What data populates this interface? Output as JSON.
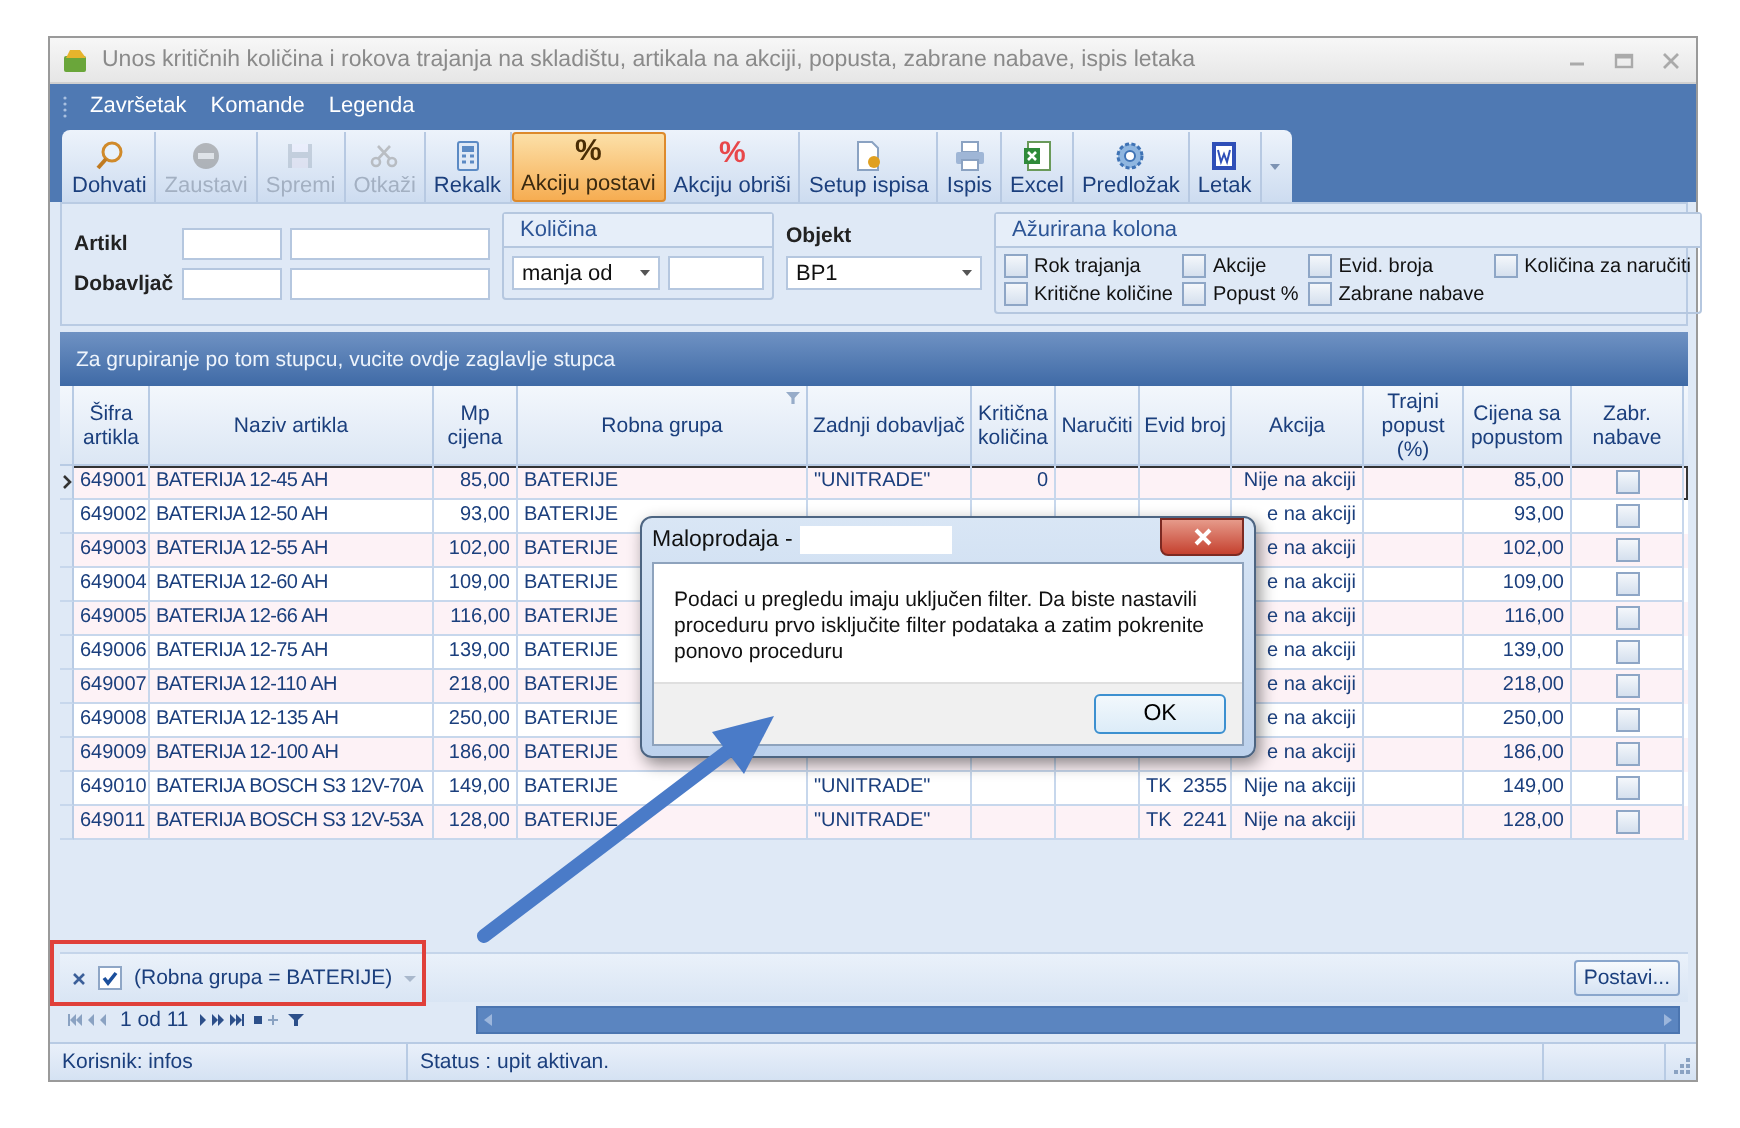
{
  "window": {
    "title": "Unos kritičnih količina i rokova trajanja na skladištu, artikala na akciji, popusta, zabrane nabave, ispis letaka"
  },
  "menu": [
    {
      "label": "Završetak"
    },
    {
      "label": "Komande"
    },
    {
      "label": "Legenda"
    }
  ],
  "toolbar": {
    "buttons": [
      {
        "label": "Dohvati",
        "disabled": false,
        "selected": false
      },
      {
        "label": "Zaustavi",
        "disabled": true,
        "selected": false
      },
      {
        "label": "Spremi",
        "disabled": true,
        "selected": false
      },
      {
        "label": "Otkaži",
        "disabled": true,
        "selected": false
      },
      {
        "label": "Rekalk",
        "disabled": false,
        "selected": false
      },
      {
        "label": "Akciju postavi",
        "glyph": "%",
        "disabled": false,
        "selected": true
      },
      {
        "label": "Akciju obriši",
        "glyph": "%",
        "disabled": false,
        "selected": false
      },
      {
        "label": "Setup ispisa",
        "disabled": false,
        "selected": false
      },
      {
        "label": "Ispis",
        "disabled": false,
        "selected": false
      },
      {
        "label": "Excel",
        "disabled": false,
        "selected": false
      },
      {
        "label": "Predložak",
        "disabled": false,
        "selected": false
      },
      {
        "label": "Letak",
        "disabled": false,
        "selected": false
      }
    ]
  },
  "filters": {
    "artikl_label": "Artikl",
    "dobavljac_label": "Dobavljač",
    "kolicina": {
      "title": "Količina",
      "operator": "manja od"
    },
    "objekt": {
      "label": "Objekt",
      "value": "BP1"
    },
    "azurirana_kolona": {
      "title": "Ažurirana kolona",
      "options": [
        {
          "label": "Rok trajanja",
          "checked": false
        },
        {
          "label": "Akcije",
          "checked": false
        },
        {
          "label": "Evid. broja",
          "checked": false
        },
        {
          "label": "Količina za naručiti",
          "checked": false
        },
        {
          "label": "Kritične količine",
          "checked": false
        },
        {
          "label": "Popust %",
          "checked": false
        },
        {
          "label": "Zabrane nabave",
          "checked": false
        }
      ]
    }
  },
  "grid": {
    "group_panel_hint": "Za grupiranje po tom stupcu, vucite ovdje zaglavlje stupca",
    "columns": [
      {
        "label": "Šifra artikla",
        "filtered": false
      },
      {
        "label": "Naziv artikla",
        "filtered": false
      },
      {
        "label": "Mp cijena",
        "filtered": false
      },
      {
        "label": "Robna grupa",
        "filtered": true
      },
      {
        "label": "Zadnji dobavljač",
        "filtered": false
      },
      {
        "label": "Kritična količina",
        "filtered": false
      },
      {
        "label": "Naručiti",
        "filtered": false
      },
      {
        "label": "Evid broj",
        "filtered": false
      },
      {
        "label": "Akcija",
        "filtered": false
      },
      {
        "label": "Trajni popust (%)",
        "filtered": false
      },
      {
        "label": "Cijena sa popustom",
        "filtered": false
      },
      {
        "label": "Zabr. nabave",
        "filtered": false
      }
    ],
    "rows": [
      {
        "sifra": "649001",
        "naziv": "BATERIJA 12-45 AH",
        "mp_cijena": "85,00",
        "robna_grupa": "BATERIJE",
        "zadnji_dobavljac": "\"UNITRADE\"",
        "kriticna_kolicina": "0",
        "akcija": "Nije na akciji",
        "cijena_sa_popustom": "85,00",
        "zabr_nabave": false,
        "selected": true
      },
      {
        "sifra": "649002",
        "naziv": "BATERIJA 12-50 AH",
        "mp_cijena": "93,00",
        "robna_grupa": "BATERIJE",
        "akcija": "e na akciji",
        "cijena_sa_popustom": "93,00",
        "zabr_nabave": false,
        "selected": false
      },
      {
        "sifra": "649003",
        "naziv": "BATERIJA 12-55 AH",
        "mp_cijena": "102,00",
        "robna_grupa": "BATERIJE",
        "akcija": "e na akciji",
        "cijena_sa_popustom": "102,00",
        "zabr_nabave": false,
        "selected": false
      },
      {
        "sifra": "649004",
        "naziv": "BATERIJA 12-60 AH",
        "mp_cijena": "109,00",
        "robna_grupa": "BATERIJE",
        "akcija": "e na akciji",
        "cijena_sa_popustom": "109,00",
        "zabr_nabave": false,
        "selected": false
      },
      {
        "sifra": "649005",
        "naziv": "BATERIJA 12-66 AH",
        "mp_cijena": "116,00",
        "robna_grupa": "BATERIJE",
        "akcija": "e na akciji",
        "cijena_sa_popustom": "116,00",
        "zabr_nabave": false,
        "selected": false
      },
      {
        "sifra": "649006",
        "naziv": "BATERIJA 12-75 AH",
        "mp_cijena": "139,00",
        "robna_grupa": "BATERIJE",
        "akcija": "e na akciji",
        "cijena_sa_popustom": "139,00",
        "zabr_nabave": false,
        "selected": false
      },
      {
        "sifra": "649007",
        "naziv": "BATERIJA 12-110 AH",
        "mp_cijena": "218,00",
        "robna_grupa": "BATERIJE",
        "akcija": "e na akciji",
        "cijena_sa_popustom": "218,00",
        "zabr_nabave": false,
        "selected": false
      },
      {
        "sifra": "649008",
        "naziv": "BATERIJA 12-135 AH",
        "mp_cijena": "250,00",
        "robna_grupa": "BATERIJE",
        "akcija": "e na akciji",
        "cijena_sa_popustom": "250,00",
        "zabr_nabave": false,
        "selected": false
      },
      {
        "sifra": "649009",
        "naziv": "BATERIJA 12-100 AH",
        "mp_cijena": "186,00",
        "robna_grupa": "BATERIJE",
        "akcija": "e na akciji",
        "cijena_sa_popustom": "186,00",
        "zabr_nabave": false,
        "selected": false
      },
      {
        "sifra": "649010",
        "naziv": "BATERIJA BOSCH S3 12V-70A",
        "mp_cijena": "149,00",
        "robna_grupa": "BATERIJE",
        "zadnji_dobavljac": "\"UNITRADE\"",
        "evid_broj": "TK  2355",
        "akcija": "Nije na akciji",
        "cijena_sa_popustom": "149,00",
        "zabr_nabave": false,
        "selected": false
      },
      {
        "sifra": "649011",
        "naziv": "BATERIJA BOSCH S3 12V-53A",
        "mp_cijena": "128,00",
        "robna_grupa": "BATERIJE",
        "zadnji_dobavljac": "\"UNITRADE\"",
        "evid_broj": "TK  2241",
        "akcija": "Nije na akciji",
        "cijena_sa_popustom": "128,00",
        "zabr_nabave": false,
        "selected": false
      }
    ]
  },
  "dialog": {
    "title": "Maloprodaja -",
    "message": "Podaci u pregledu imaju uključen filter. Da biste nastavili proceduru prvo isključite filter podataka a zatim pokrenite ponovo proceduru",
    "button": "OK"
  },
  "filter_bar": {
    "checked": true,
    "condition": "(Robna grupa = BATERIJE)",
    "button": "Postavi..."
  },
  "navigator": {
    "position": "1 od 11"
  },
  "status_bar": [
    {
      "text": "Korisnik: infos"
    },
    {
      "text": "Status : upit aktivan."
    }
  ]
}
